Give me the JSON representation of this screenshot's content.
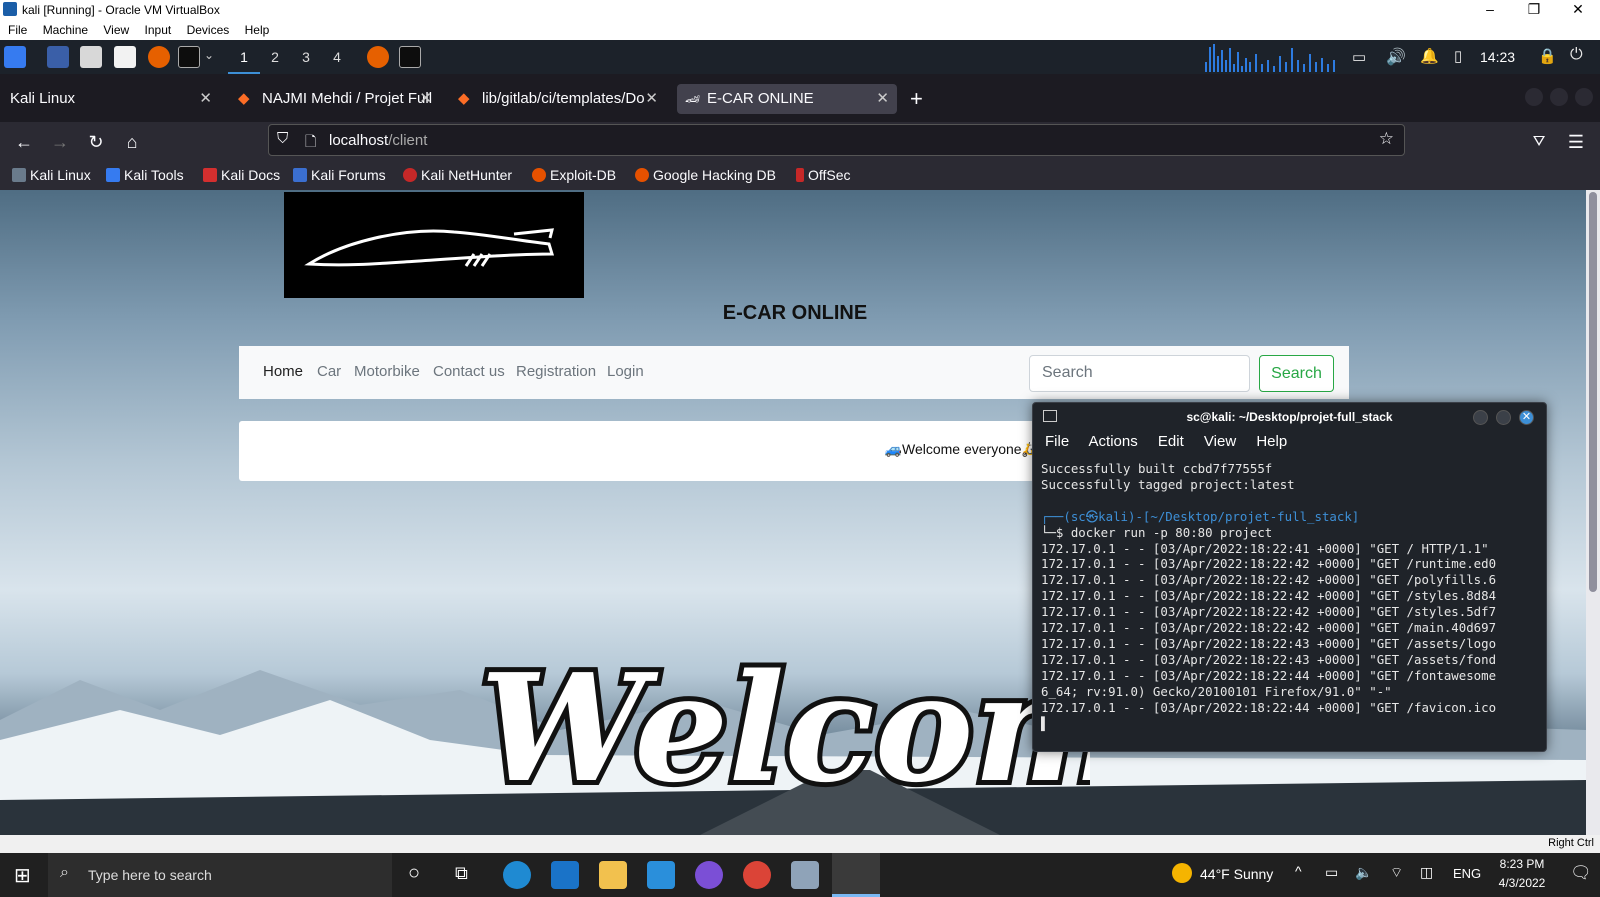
{
  "vbox": {
    "title": "kali [Running] - Oracle VM VirtualBox",
    "menu": [
      "File",
      "Machine",
      "View",
      "Input",
      "Devices",
      "Help"
    ],
    "status_hostkey": "Right Ctrl"
  },
  "kali_panel": {
    "workspaces": [
      "1",
      "2",
      "3",
      "4"
    ],
    "active_workspace": "1",
    "clock": "14:23"
  },
  "browser": {
    "tabs": [
      {
        "label": "Kali Linux"
      },
      {
        "label": "NAJMI Mehdi / Projet Full"
      },
      {
        "label": "lib/gitlab/ci/templates/Do"
      },
      {
        "label": "E-CAR ONLINE",
        "active": true
      }
    ],
    "new_tab_label": "+",
    "url_host": "localhost",
    "url_path": "/client",
    "bookmarks": [
      "Kali Linux",
      "Kali Tools",
      "Kali Docs",
      "Kali Forums",
      "Kali NetHunter",
      "Exploit-DB",
      "Google Hacking DB",
      "OffSec"
    ]
  },
  "site": {
    "title": "E-CAR ONLINE",
    "nav": [
      "Home",
      "Car",
      "Motorbike",
      "Contact us",
      "Registration",
      "Login"
    ],
    "search_placeholder": "Search",
    "search_button": "Search",
    "welcome_text": "🚙Welcome everyone🛵",
    "banner_text": "Welcome"
  },
  "terminal": {
    "title": "sc@kali: ~/Desktop/projet-full_stack",
    "menu": [
      "File",
      "Actions",
      "Edit",
      "View",
      "Help"
    ],
    "lines": [
      "Successfully built ccbd7f77555f",
      "Successfully tagged project:latest",
      "",
      "┌──(sc㉿kali)-[~/Desktop/projet-full_stack]",
      "└─$ docker run -p 80:80 project",
      "172.17.0.1 - - [03/Apr/2022:18:22:41 +0000] \"GET / HTTP/1.1\"",
      "172.17.0.1 - - [03/Apr/2022:18:22:42 +0000] \"GET /runtime.ed0",
      "172.17.0.1 - - [03/Apr/2022:18:22:42 +0000] \"GET /polyfills.6",
      "172.17.0.1 - - [03/Apr/2022:18:22:42 +0000] \"GET /styles.8d84",
      "172.17.0.1 - - [03/Apr/2022:18:22:42 +0000] \"GET /styles.5df7",
      "172.17.0.1 - - [03/Apr/2022:18:22:42 +0000] \"GET /main.40d697",
      "172.17.0.1 - - [03/Apr/2022:18:22:43 +0000] \"GET /assets/logo",
      "172.17.0.1 - - [03/Apr/2022:18:22:43 +0000] \"GET /assets/fond",
      "172.17.0.1 - - [03/Apr/2022:18:22:44 +0000] \"GET /fontawesome",
      "6_64; rv:91.0) Gecko/20100101 Firefox/91.0\" \"-\"",
      "172.17.0.1 - - [03/Apr/2022:18:22:44 +0000] \"GET /favicon.ico",
      "▌"
    ]
  },
  "taskbar": {
    "search_placeholder": "Type here to search",
    "weather": "44°F  Sunny",
    "lang": "ENG",
    "time": "8:23 PM",
    "date": "4/3/2022"
  },
  "colors": {
    "kali_panel": "#1c222a",
    "firefox_tabbar": "#1c1b22",
    "firefox_toolbar": "#2b2a33",
    "search_green": "#28a745",
    "terminal_bg": "#1f2329",
    "taskbar": "#202020"
  }
}
